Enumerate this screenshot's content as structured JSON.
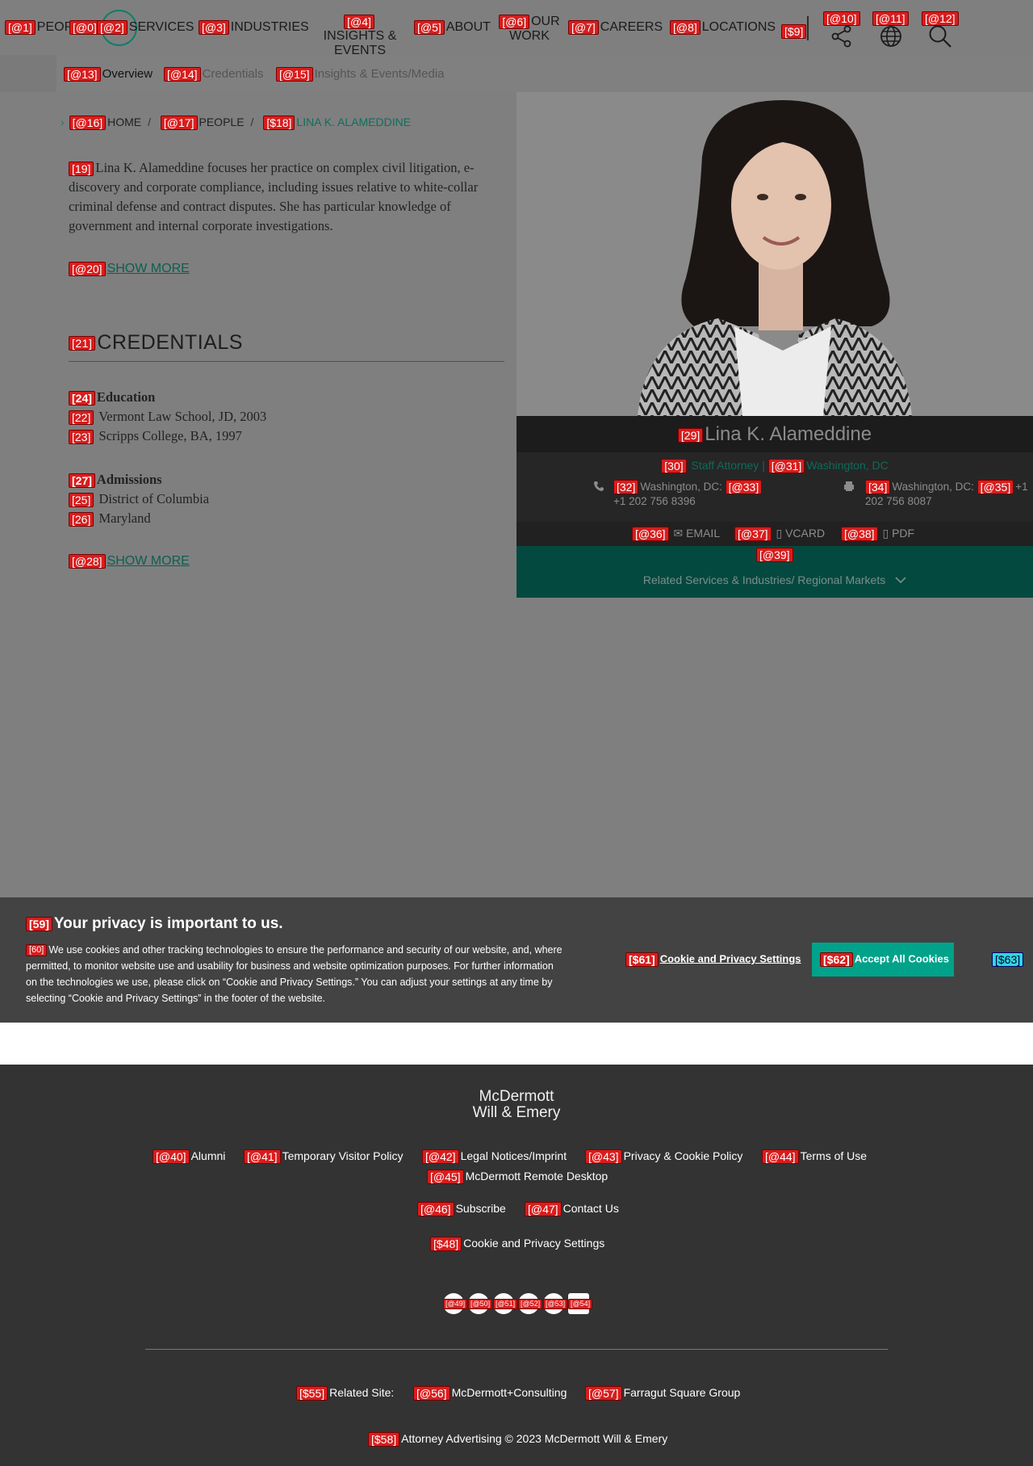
{
  "nav": {
    "items": [
      {
        "badge": "[@1]",
        "label": "PEOP"
      },
      {
        "badge": "[@0]",
        "label": ""
      },
      {
        "badge": "[@2]",
        "label": "SERVICES"
      },
      {
        "badge": "[@3]",
        "label": "INDUSTRIES"
      },
      {
        "badge": "[@4]",
        "label": "INSIGHTS & EVENTS"
      },
      {
        "badge": "[@5]",
        "label": "ABOUT"
      },
      {
        "badge": "[@6]",
        "label": "OUR WORK"
      },
      {
        "badge": "[@7]",
        "label": "CAREERS"
      },
      {
        "badge": "[@8]",
        "label": "LOCATIONS"
      },
      {
        "badge": "[$9]",
        "label": ""
      }
    ],
    "icons": [
      {
        "badge": "[@10]",
        "name": "share-icon"
      },
      {
        "badge": "[@11]",
        "name": "globe-icon"
      },
      {
        "badge": "[@12]",
        "name": "search-icon"
      }
    ]
  },
  "subnav": [
    {
      "badge": "[@13]",
      "label": "Overview"
    },
    {
      "badge": "[@14]",
      "label": "Credentials"
    },
    {
      "badge": "[@15]",
      "label": "Insights & Events/Media"
    }
  ],
  "breadcrumb": [
    {
      "badge": "[@16]",
      "label": "HOME"
    },
    {
      "badge": "[@17]",
      "label": "PEOPLE"
    },
    {
      "badge": "[$18]",
      "label": "LINA K. ALAMEDDINE"
    }
  ],
  "bio": {
    "badge": "[19]",
    "text": "Lina K. Alameddine focuses her practice on complex civil litigation, e-discovery and corporate compliance, including issues relative to white-collar criminal defense and contract disputes. She has particular knowledge of government and internal corporate investigations."
  },
  "show_more_1": {
    "badge": "[@20]",
    "label": "SHOW MORE"
  },
  "credentials": {
    "badge": "[21]",
    "title": "CREDENTIALS",
    "education_badge": "[24]",
    "education_title": "Education",
    "education": [
      {
        "badge": "[22]",
        "text": "Vermont Law School, JD, 2003"
      },
      {
        "badge": "[23]",
        "text": "Scripps College, BA, 1997"
      }
    ],
    "admissions_badge": "[27]",
    "admissions_title": "Admissions",
    "admissions": [
      {
        "badge": "[25]",
        "text": "District of Columbia"
      },
      {
        "badge": "[26]",
        "text": "Maryland"
      }
    ]
  },
  "show_more_2": {
    "badge": "[@28]",
    "label": "SHOW MORE"
  },
  "profile": {
    "name_badge": "[29]",
    "name": "Lina K. Alameddine",
    "role_badge": "[30]",
    "role": "Staff Attorney",
    "office_badge": "[@31]",
    "office": "Washington, DC",
    "phone_badge": "[32]",
    "phone_label": "Washington, DC:",
    "phone_link_badge": "[@33]",
    "phone_value": "+1 202 756 8396",
    "fax_badge": "[34]",
    "fax_label": "Washington, DC:",
    "fax_link_badge": "[@35]",
    "fax_value": "+1 202 756 8087",
    "email_badge": "[@36]",
    "email": "EMAIL",
    "vcard_badge": "[@37]",
    "vcard": "VCARD",
    "pdf_badge": "[@38]",
    "pdf": "PDF",
    "related_badge": "[@39]",
    "related": "Related Services & Industries/ Regional Markets"
  },
  "cookie": {
    "title_badge": "[59]",
    "title": "Your privacy is important to us.",
    "body_badge": "[60]",
    "body": "We use cookies and other tracking technologies to ensure the performance and security of our website, and, where permitted, to monitor website use and usability for business and website optimization purposes. For further information on the technologies we use, please click on “Cookie and Privacy Settings.” You can adjust your settings at any time by selecting “Cookie and Privacy Settings” in the footer of the website.",
    "settings_badge": "[$61]",
    "settings": "Cookie and Privacy Settings",
    "accept_badge": "[$62]",
    "accept": "Accept All Cookies",
    "close_badge": "[$63]"
  },
  "footer": {
    "logo_line1": "McDermott",
    "logo_line2": "Will & Emery",
    "links_row1": [
      {
        "badge": "[@40]",
        "label": "Alumni"
      },
      {
        "badge": "[@41]",
        "label": "Temporary Visitor Policy"
      },
      {
        "badge": "[@42]",
        "label": "Legal Notices/Imprint"
      },
      {
        "badge": "[@43]",
        "label": "Privacy & Cookie Policy"
      },
      {
        "badge": "[@44]",
        "label": "Terms of Use"
      }
    ],
    "remote": {
      "badge": "[@45]",
      "label": "McDermott Remote Desktop"
    },
    "subscribe": {
      "badge": "[@46]",
      "label": "Subscribe"
    },
    "contact": {
      "badge": "[@47]",
      "label": "Contact Us"
    },
    "cookie_settings": {
      "badge": "[$48]",
      "label": "Cookie and Privacy Settings"
    },
    "socials": [
      "[@49]",
      "[@50]",
      "[@51]",
      "[@52]",
      "[@53]",
      "[@54]"
    ],
    "related_site": {
      "badge": "[$55]",
      "label": "Related Site:"
    },
    "consulting": {
      "badge": "[@56]",
      "label": "McDermott+Consulting"
    },
    "farragut": {
      "badge": "[@57]",
      "label": "Farragut Square Group"
    },
    "copyright": {
      "badge": "[$58]",
      "label": "Attorney Advertising © 2023 McDermott Will & Emery"
    }
  },
  "colors": {
    "accent": "#0f7e6a",
    "cookie_accept": "#00a28a",
    "footer_bg": "#333333",
    "badge": "#d81d1d"
  }
}
